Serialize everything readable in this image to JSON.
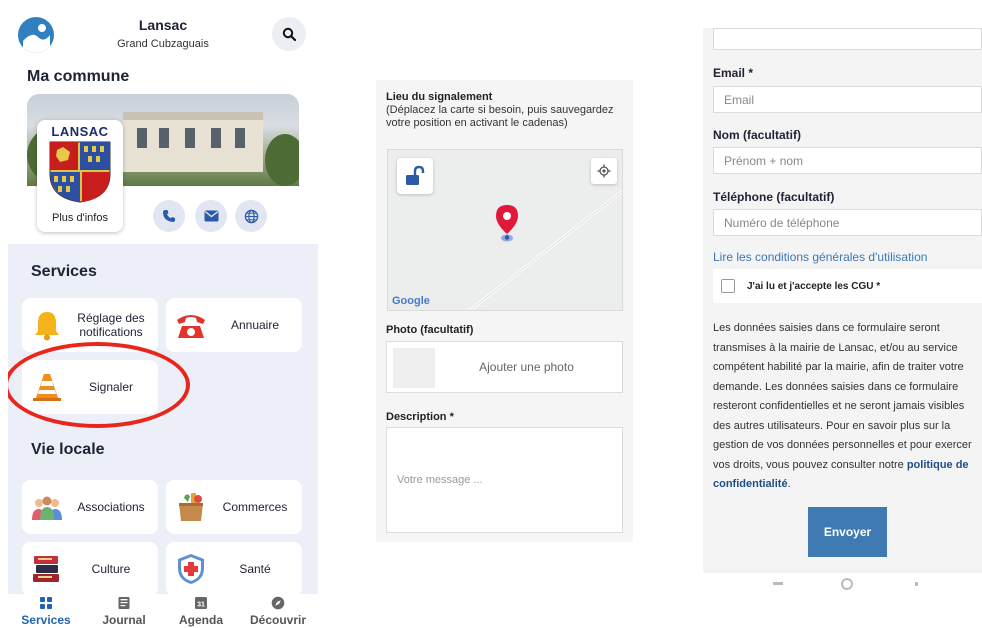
{
  "app": {
    "town": "Lansac",
    "region": "Grand Cubzaguais",
    "commune_title": "Ma commune",
    "crest_name": "LANSAC",
    "more_info": "Plus d'infos"
  },
  "services": {
    "title": "Services",
    "items": [
      {
        "label": "Réglage des notifications",
        "icon": "bell-icon"
      },
      {
        "label": "Annuaire",
        "icon": "telephone-icon"
      },
      {
        "label": "Signaler",
        "icon": "traffic-cone-icon"
      }
    ]
  },
  "vie_locale": {
    "title": "Vie locale",
    "items": [
      {
        "label": "Associations",
        "icon": "people-icon"
      },
      {
        "label": "Commerces",
        "icon": "shopping-bag-icon"
      },
      {
        "label": "Culture",
        "icon": "books-icon"
      },
      {
        "label": "Santé",
        "icon": "medical-shield-icon"
      }
    ]
  },
  "bottom_nav": [
    {
      "label": "Services",
      "icon": "grid-icon",
      "active": true
    },
    {
      "label": "Journal",
      "icon": "newspaper-icon",
      "active": false
    },
    {
      "label": "Agenda",
      "icon": "calendar-icon",
      "day": "31",
      "active": false
    },
    {
      "label": "Découvrir",
      "icon": "compass-icon",
      "active": false
    }
  ],
  "report_form": {
    "location_label": "Lieu du signalement",
    "location_hint": "(Déplacez la carte si besoin, puis sauvegardez votre position en activant le cadenas)",
    "map_attribution": "Google",
    "photo_label": "Photo (facultatif)",
    "photo_button": "Ajouter une photo",
    "description_label": "Description *",
    "description_placeholder": "Votre message ..."
  },
  "contact_form": {
    "email_label": "Email *",
    "email_placeholder": "Email",
    "name_label": "Nom (facultatif)",
    "name_placeholder": "Prénom + nom",
    "phone_label": "Téléphone (facultatif)",
    "phone_placeholder": "Numéro de téléphone",
    "cgu_link": "Lire les conditions générales d'utilisation",
    "cgu_checkbox": "J'ai lu et j'accepte les CGU *",
    "legal_text": "Les données saisies dans ce formulaire seront transmises à la mairie de Lansac, et/ou au service compétent habilité par la mairie, afin de traiter votre demande. Les données saisies dans ce formulaire resteront confidentielles et ne seront jamais visibles des autres utilisateurs. Pour en savoir plus sur la gestion de vos données personnelles et pour exercer vos droits, vous pouvez consulter notre",
    "privacy_link": "politique de confidentialité",
    "submit": "Envoyer"
  },
  "colors": {
    "primary_blue": "#1f63b3",
    "button_blue": "#3f7bb2",
    "highlight_red": "#e8261c",
    "services_background": "#eceef8"
  }
}
